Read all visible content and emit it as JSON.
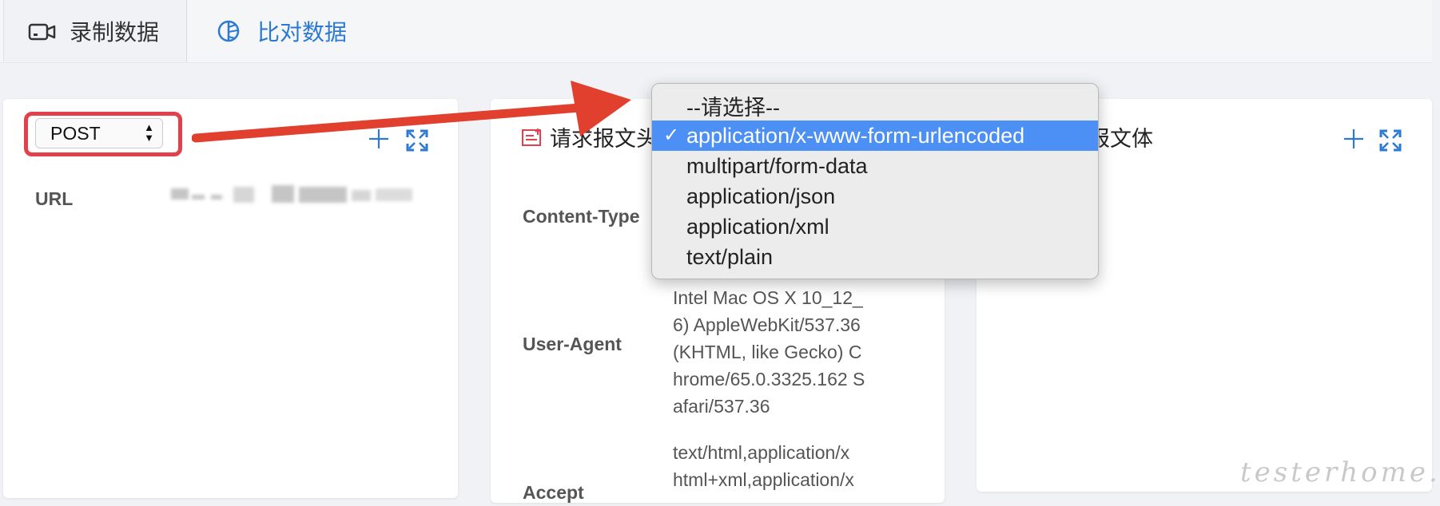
{
  "tabs": [
    {
      "label": "录制数据",
      "icon": "video-camera-icon",
      "active": true
    },
    {
      "label": "比对数据",
      "icon": "pie-compare-icon",
      "active": false
    }
  ],
  "left_panel": {
    "method": {
      "value": "POST"
    },
    "url_label": "URL",
    "url_value_redacted": true
  },
  "headers_panel": {
    "title_visible": "请求报文头",
    "rows": [
      {
        "key": "Content-Type",
        "value": ""
      },
      {
        "key": "User-Agent",
        "value_lines": [
          "Intel Mac OS X 10_12_",
          "6) AppleWebKit/537.36",
          "(KHTML, like Gecko) C",
          "hrome/65.0.3325.162 S",
          "afari/537.36"
        ]
      },
      {
        "key": "Accept",
        "value_lines": [
          "text/html,application/x",
          "html+xml,application/x"
        ]
      }
    ]
  },
  "body_panel": {
    "title_visible": "报文体"
  },
  "content_type_dropdown": {
    "options": [
      "--请选择--",
      "application/x-www-form-urlencoded",
      "multipart/form-data",
      "application/json",
      "application/xml",
      "text/plain"
    ],
    "selected_index": 1,
    "check_mark": "✓"
  },
  "annotation": {
    "highlight_color": "#e2404a",
    "arrow_color": "#e2402e"
  },
  "watermark": "testerhome.com",
  "colors": {
    "accent": "#2b79d4",
    "selection": "#4c8ff5"
  }
}
